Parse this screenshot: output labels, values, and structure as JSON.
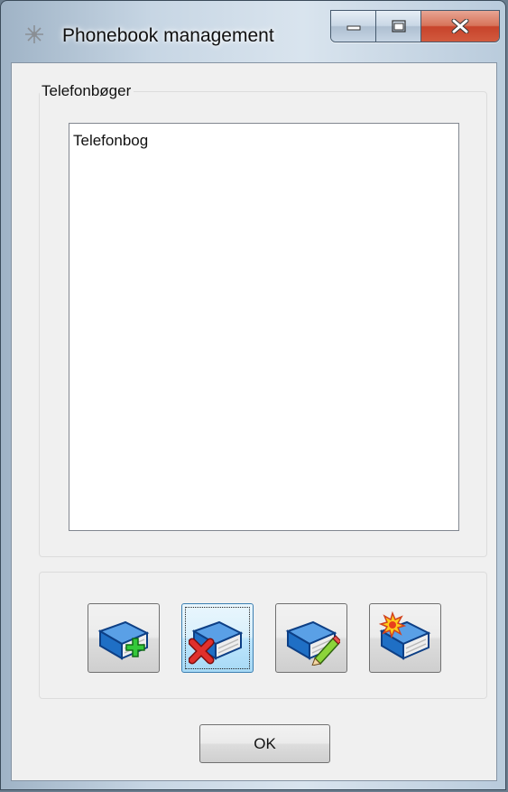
{
  "window": {
    "title": "Phonebook management",
    "caption_buttons": [
      "minimize-icon",
      "maximize-icon",
      "close-icon"
    ]
  },
  "phonebooks": {
    "label": "Telefonbøger",
    "items": [
      "Telefonbog"
    ]
  },
  "toolbar": {
    "buttons": [
      {
        "icon": "book-add-icon"
      },
      {
        "icon": "book-delete-icon",
        "focused": true
      },
      {
        "icon": "book-edit-icon"
      },
      {
        "icon": "book-new-icon"
      }
    ]
  },
  "dialog": {
    "ok_label": "OK"
  },
  "colors": {
    "close_button": "#c7432b",
    "book_blue": "#1f6fc5",
    "focus_border": "#3c7fb1"
  }
}
